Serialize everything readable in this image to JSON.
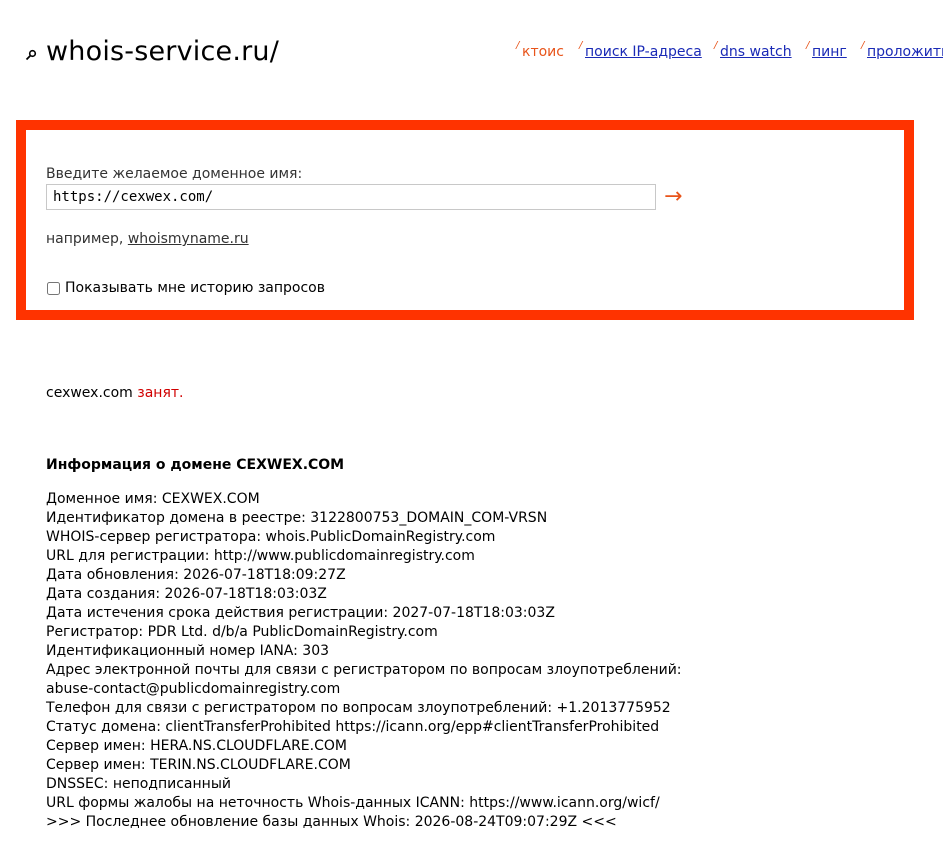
{
  "header": {
    "site_name": "whois-service.ru/",
    "nav": [
      {
        "label": "ктоис",
        "active": true
      },
      {
        "label": "поиск IP-адреса",
        "active": false
      },
      {
        "label": "dns watch",
        "active": false
      },
      {
        "label": "пинг",
        "active": false
      },
      {
        "label": "проложить",
        "active": false
      }
    ],
    "tick_mark": "/"
  },
  "search": {
    "prompt": "Введите желаемое доменное имя:",
    "value": "https://cexwex.com/",
    "submit_icon": "arrow-right-icon",
    "submit_glyph": "→",
    "example_prefix": "например, ",
    "example_link": "whoismyname.ru",
    "history_label": "Показывать мне историю запросов",
    "history_checked": false
  },
  "result": {
    "domain": "cexwex.com",
    "status": "занят."
  },
  "info": {
    "title": "Информация о домене CEXWEX.COM",
    "lines": [
      "Доменное имя: CEXWEX.COM",
      "Идентификатор домена в реестре: 3122800753_DOMAIN_COM-VRSN",
      "WHOIS-сервер регистратора: whois.PublicDomainRegistry.com",
      "URL для регистрации: http://www.publicdomainregistry.com",
      "Дата обновления: 2026-07-18T18:09:27Z",
      "Дата создания: 2026-07-18T18:03:03Z",
      "Дата истечения срока действия регистрации: 2027-07-18T18:03:03Z",
      "Регистратор: PDR Ltd. d/b/a PublicDomainRegistry.com",
      "Идентификационный номер IANA: 303",
      "Адрес электронной почты для связи с регистратором по вопросам злоупотреблений:",
      "abuse-contact@publicdomainregistry.com",
      "Телефон для связи с регистратором по вопросам злоупотреблений: +1.2013775952",
      "Статус домена: clientTransferProhibited https://icann.org/epp#clientTransferProhibited",
      "Сервер имен: HERA.NS.CLOUDFLARE.COM",
      "Сервер имен: TERIN.NS.CLOUDFLARE.COM",
      "DNSSEC: неподписанный",
      "URL формы жалобы на неточность Whois-данных ICANN: https://www.icann.org/wicf/",
      ">>> Последнее обновление базы данных Whois: 2026-08-24T09:07:29Z <<<"
    ]
  },
  "colors": {
    "accent": "#ff3300",
    "link": "#1a2ab6",
    "status_taken": "#d00000"
  }
}
